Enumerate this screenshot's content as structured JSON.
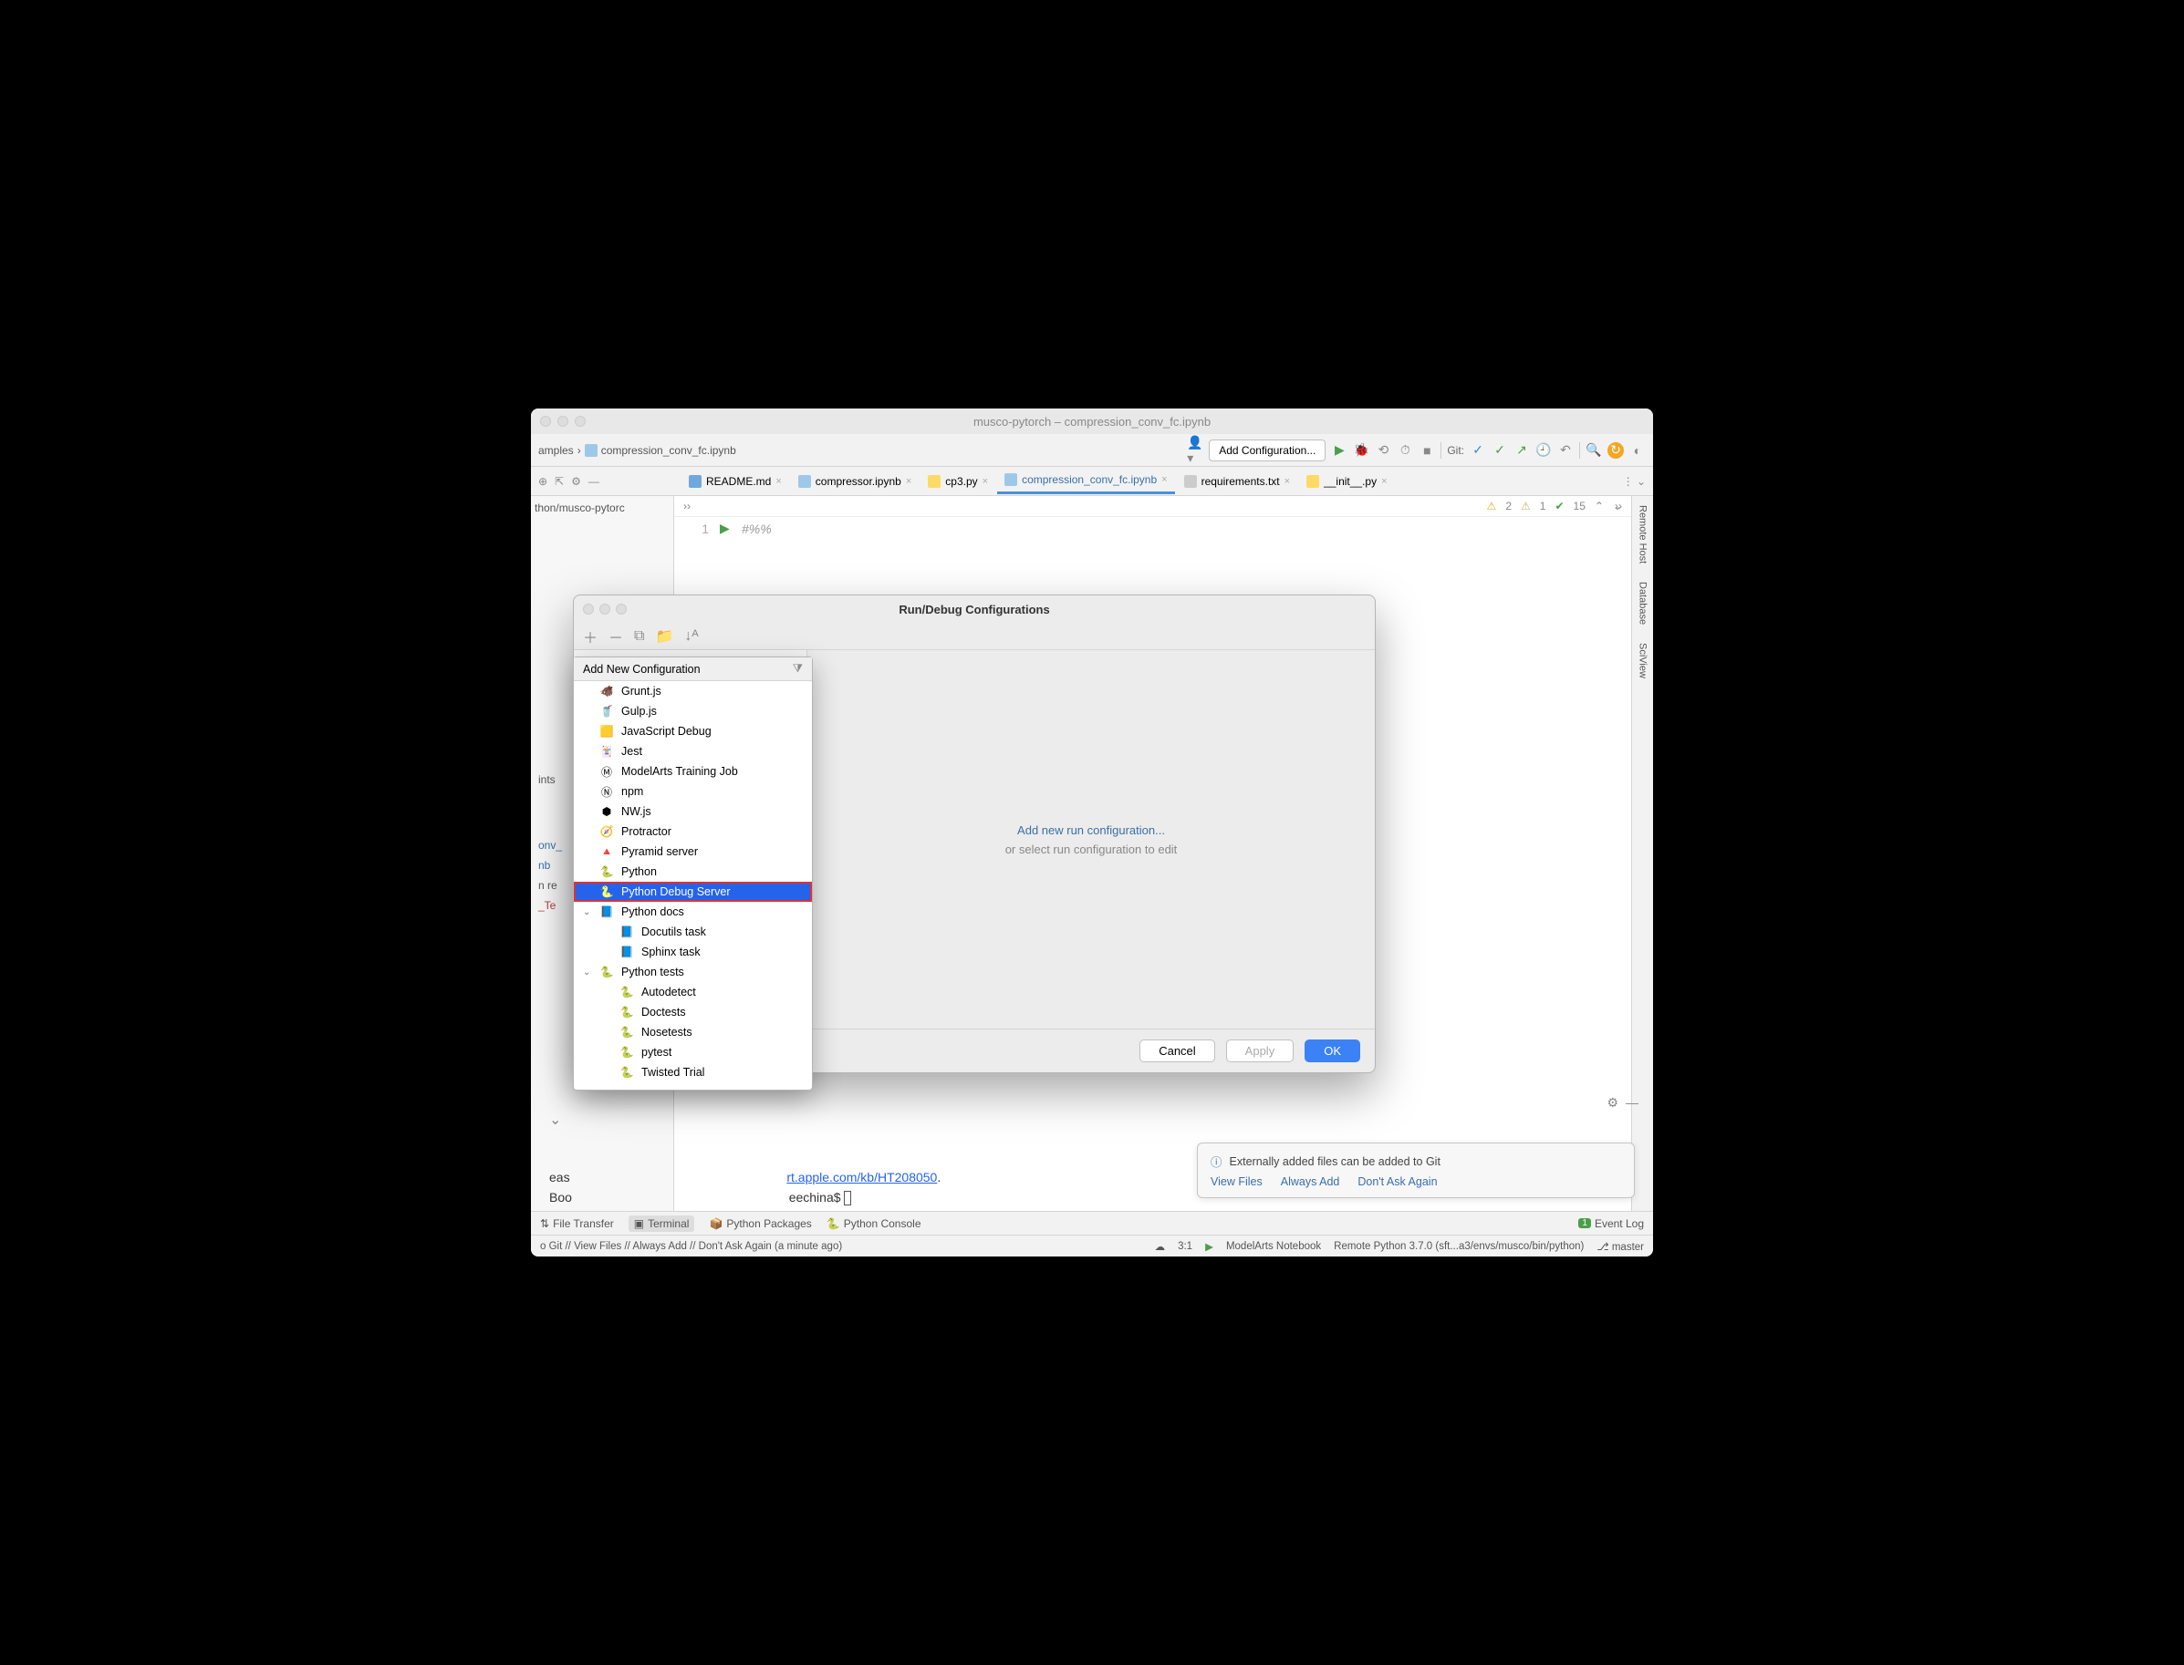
{
  "window": {
    "title": "musco-pytorch – compression_conv_fc.ipynb"
  },
  "breadcrumb": {
    "item1": "amples",
    "item2": "compression_conv_fc.ipynb"
  },
  "toolbar": {
    "configBtn": "Add Configuration...",
    "gitLabel": "Git:"
  },
  "projectPane": {
    "path": "thon/musco-pytorc"
  },
  "tabs": [
    {
      "label": "README.md",
      "iconClass": "file-icon-md",
      "active": false
    },
    {
      "label": "compressor.ipynb",
      "iconClass": "file-icon-ipynb",
      "active": false
    },
    {
      "label": "cp3.py",
      "iconClass": "file-icon-py",
      "active": false
    },
    {
      "label": "compression_conv_fc.ipynb",
      "iconClass": "file-icon-ipynb",
      "active": true
    },
    {
      "label": "requirements.txt",
      "iconClass": "file-icon-txt",
      "active": false
    },
    {
      "label": "__init__.py",
      "iconClass": "file-icon-py",
      "active": false
    }
  ],
  "editor": {
    "lineNumber": "1",
    "code": "#%%",
    "inspections": {
      "warn1": "2",
      "warn2": "1",
      "check": "15"
    }
  },
  "rightBar": {
    "item1": "Remote Host",
    "item2": "Database",
    "item3": "SciView"
  },
  "dialog": {
    "title": "Run/Debug Configurations",
    "link": "Add new run configuration...",
    "sub": "or select run configuration to edit",
    "cancel": "Cancel",
    "apply": "Apply",
    "ok": "OK"
  },
  "popup": {
    "header": "Add New Configuration",
    "items": [
      {
        "label": "Grunt.js",
        "icon": "🐗",
        "nested": false
      },
      {
        "label": "Gulp.js",
        "icon": "🥤",
        "nested": false
      },
      {
        "label": "JavaScript Debug",
        "icon": "🟨",
        "nested": false
      },
      {
        "label": "Jest",
        "icon": "🃏",
        "nested": false
      },
      {
        "label": "ModelArts Training Job",
        "icon": "Ⓜ",
        "nested": false
      },
      {
        "label": "npm",
        "icon": "Ⓝ",
        "nested": false
      },
      {
        "label": "NW.js",
        "icon": "⬢",
        "nested": false
      },
      {
        "label": "Protractor",
        "icon": "🧭",
        "nested": false
      },
      {
        "label": "Pyramid server",
        "icon": "🔺",
        "nested": false
      },
      {
        "label": "Python",
        "icon": "🐍",
        "nested": false
      },
      {
        "label": "Python Debug Server",
        "icon": "🐍",
        "nested": false,
        "selected": true,
        "highlighted": true
      },
      {
        "label": "Python docs",
        "icon": "📘",
        "nested": false,
        "expandable": true
      },
      {
        "label": "Docutils task",
        "icon": "📘",
        "nested": true
      },
      {
        "label": "Sphinx task",
        "icon": "📘",
        "nested": true
      },
      {
        "label": "Python tests",
        "icon": "🐍",
        "nested": false,
        "expandable": true
      },
      {
        "label": "Autodetect",
        "icon": "🐍",
        "nested": true
      },
      {
        "label": "Doctests",
        "icon": "🐍",
        "nested": true
      },
      {
        "label": "Nosetests",
        "icon": "🐍",
        "nested": true
      },
      {
        "label": "pytest",
        "icon": "🐍",
        "nested": true
      },
      {
        "label": "Twisted Trial",
        "icon": "🐍",
        "nested": true
      }
    ]
  },
  "leftHints": {
    "l1": "ints",
    "l2": "onv_",
    "l3": "nb",
    "l4": "n re",
    "l5": "_Te"
  },
  "terminal": {
    "line1_pre": "eas",
    "line1_link": "rt.apple.com/kb/HT208050",
    "line1_post": ".",
    "line2_pre": "Boo",
    "line2_prompt": "eechina$ "
  },
  "notification": {
    "title": "Externally added files can be added to Git",
    "links": {
      "view": "View Files",
      "always": "Always Add",
      "dont": "Don't Ask Again"
    }
  },
  "bottomTabs": {
    "fileTransfer": "File Transfer",
    "terminal": "Terminal",
    "pkgs": "Python Packages",
    "console": "Python Console",
    "eventLog": "Event Log"
  },
  "statusBar": {
    "left": "o Git // View Files // Always Add // Don't Ask Again (a minute ago)",
    "pos": "3:1",
    "notebook": "ModelArts Notebook",
    "interpreter": "Remote Python 3.7.0 (sft...a3/envs/musco/bin/python)",
    "branch": "master"
  }
}
